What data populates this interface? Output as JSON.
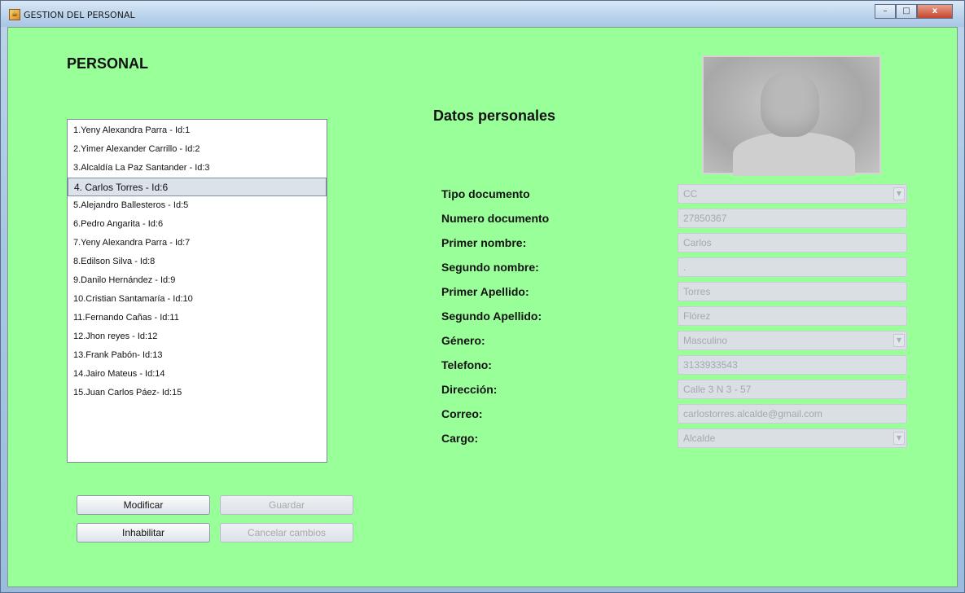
{
  "window": {
    "title": "GESTION DEL PERSONAL",
    "minimize_glyph": "–",
    "maximize_glyph": "□",
    "close_glyph": "x"
  },
  "left": {
    "heading": "PERSONAL",
    "list_items": [
      "1.Yeny Alexandra Parra - Id:1",
      "2.Yimer Alexander Carrillo - Id:2",
      "3.Alcaldía La Paz Santander - Id:3",
      "4. Carlos Torres - Id:6",
      "5.Alejandro Ballesteros - Id:5",
      "6.Pedro Angarita - Id:6",
      "7.Yeny Alexandra Parra - Id:7",
      "8.Edilson Silva - Id:8",
      "9.Danilo Hernández - Id:9",
      "10.Cristian Santamaría - Id:10",
      "11.Fernando Cañas  - Id:11",
      "12.Jhon reyes - Id:12",
      "13.Frank Pabón- Id:13",
      "14.Jairo Mateus - Id:14",
      "15.Juan Carlos Páez- Id:15"
    ],
    "selected_index": 3,
    "buttons": {
      "modificar": "Modificar",
      "guardar": "Guardar",
      "inhabilitar": "Inhabilitar",
      "cancelar": "Cancelar cambios"
    }
  },
  "right": {
    "section_title": "Datos personales",
    "fields": {
      "tipo_documento": {
        "label": "Tipo documento",
        "value": "CC"
      },
      "numero_documento": {
        "label": "Numero documento",
        "value": "27850367"
      },
      "primer_nombre": {
        "label": "Primer nombre:",
        "value": "Carlos"
      },
      "segundo_nombre": {
        "label": "Segundo nombre:",
        "value": "."
      },
      "primer_apellido": {
        "label": "Primer Apellido:",
        "value": "Torres"
      },
      "segundo_apellido": {
        "label": "Segundo Apellido:",
        "value": "Flórez"
      },
      "genero": {
        "label": "Género:",
        "value": "Masculino"
      },
      "telefono": {
        "label": "Telefono:",
        "value": "3133933543"
      },
      "direccion": {
        "label": "Dirección:",
        "value": "Calle 3 N 3 - 57"
      },
      "correo": {
        "label": "Correo:",
        "value": "carlostorres.alcalde@gmail.com"
      },
      "cargo": {
        "label": "Cargo:",
        "value": "Alcalde"
      }
    },
    "dropdown_glyph": "▼"
  },
  "colors": {
    "panel_background": "#99ff99",
    "disabled_field": "#dadfe4",
    "disabled_text": "#a3a9ae"
  }
}
